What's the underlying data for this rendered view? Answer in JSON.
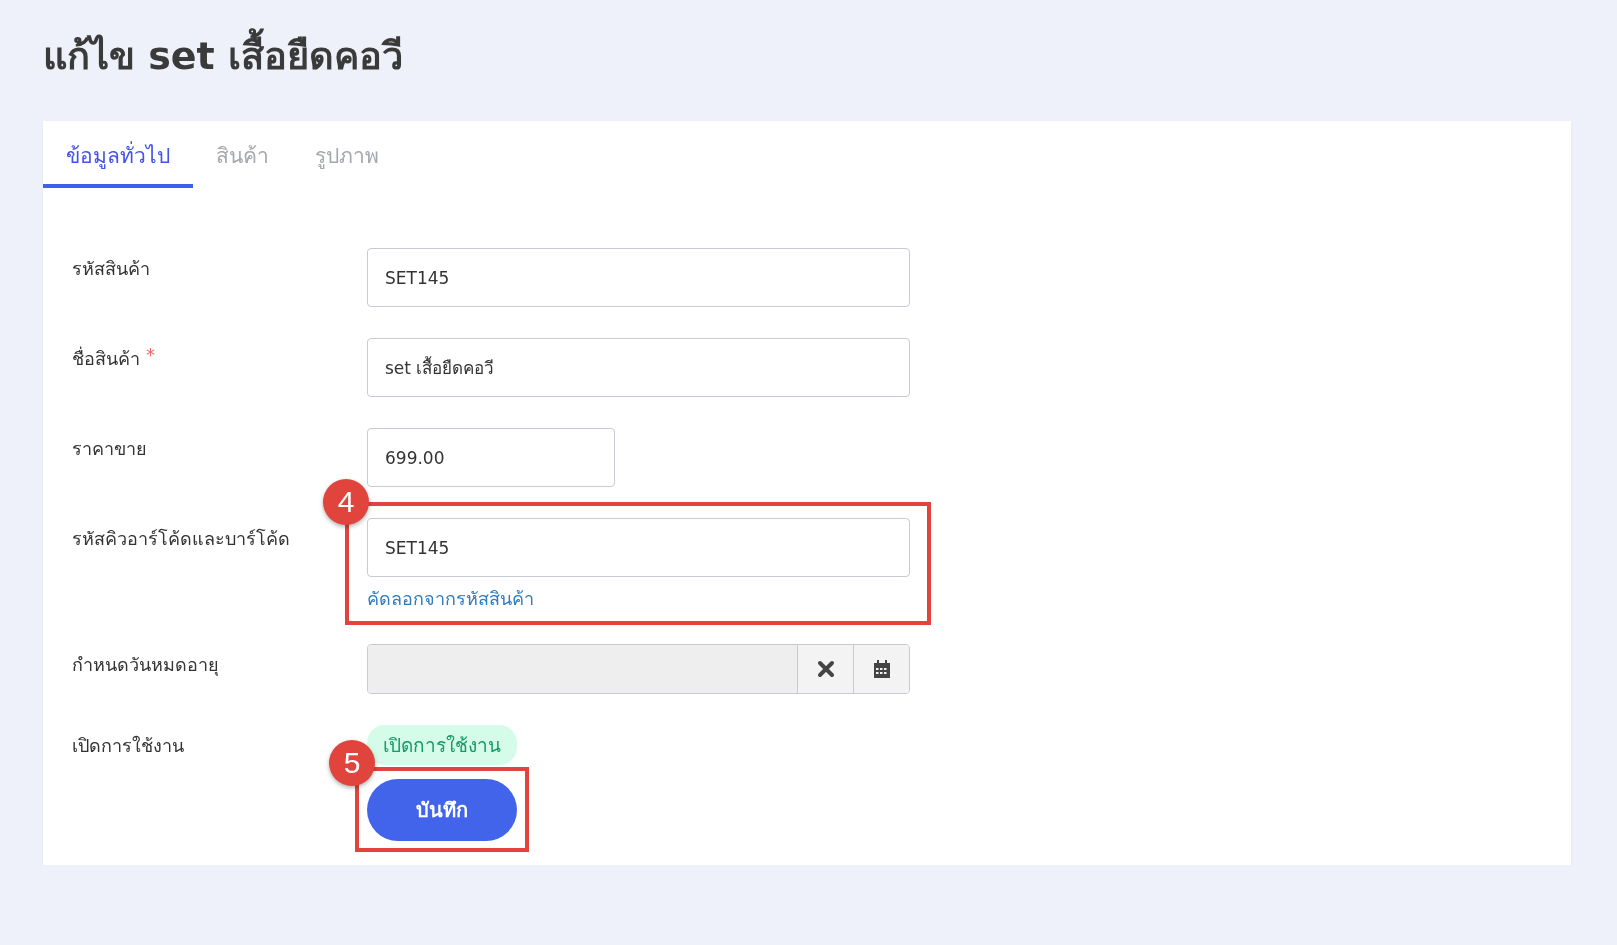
{
  "page_title": "แก้ไข set เสื้อยืดคอวี",
  "tabs": [
    {
      "label": "ข้อมูลทั่วไป",
      "selected": true
    },
    {
      "label": "สินค้า",
      "selected": false
    },
    {
      "label": "รูปภาพ",
      "selected": false
    }
  ],
  "fields": [
    {
      "kind": "text",
      "label": "รหัสสินค้า",
      "value": "SET145"
    },
    {
      "kind": "text",
      "label": "ชื่อสินค้า",
      "required_mark": "*",
      "value": "set เสื้อยืดคอวี"
    },
    {
      "kind": "short",
      "label": "ราคาขาย",
      "value": "699.00"
    },
    {
      "kind": "text",
      "label": "รหัสคิวอาร์โค้ดและบาร์โค้ด",
      "value": "SET145",
      "link": "คัดลอกจากรหัสสินค้า",
      "annotation": "4"
    },
    {
      "kind": "date",
      "label": "กำหนดวันหมดอายุ"
    },
    {
      "kind": "status",
      "label": "เปิดการใช้งาน",
      "status": "เปิดการใช้งาน",
      "on": true
    }
  ],
  "save_button": {
    "label": "บันทึก",
    "annotation": "5"
  }
}
